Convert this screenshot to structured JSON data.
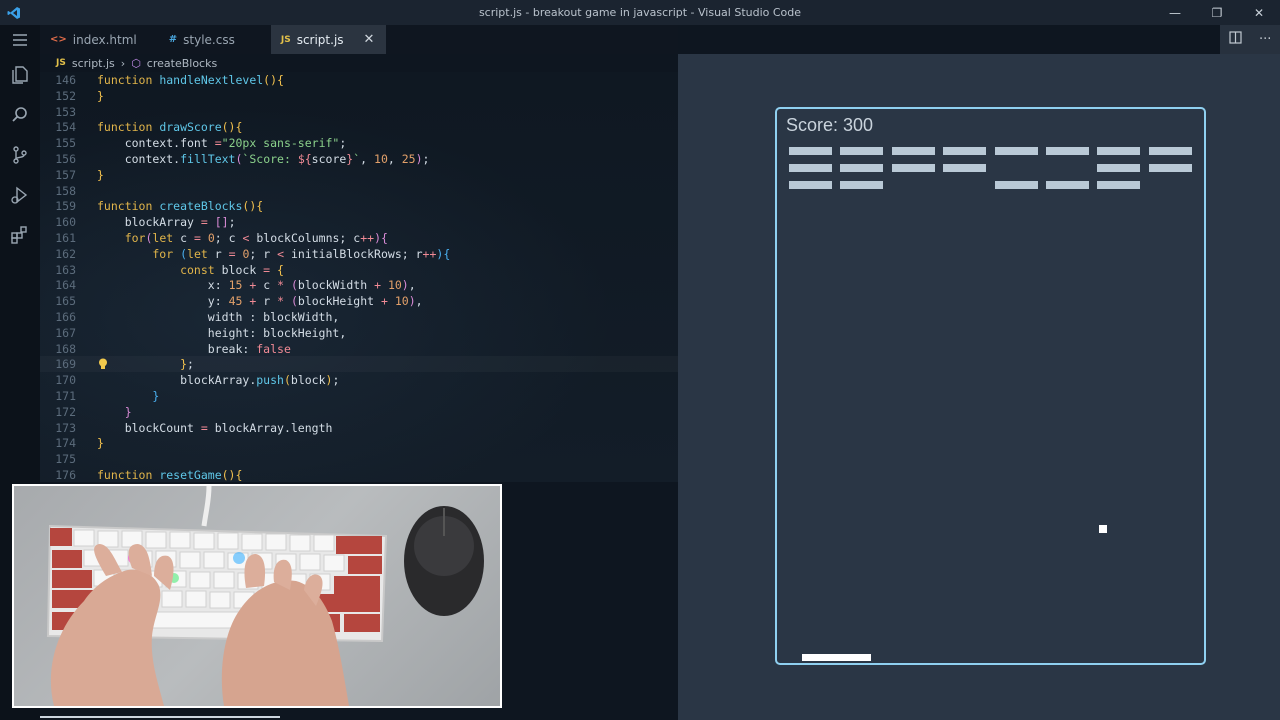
{
  "window": {
    "title": "script.js - breakout game in javascript - Visual Studio Code",
    "controls": {
      "minimize": "—",
      "maximize": "❐",
      "close": "✕"
    }
  },
  "activitybar": {
    "icons": [
      "files-icon",
      "search-icon",
      "source-control-icon",
      "run-debug-icon",
      "extensions-icon"
    ]
  },
  "tabs": [
    {
      "label": "index.html",
      "icon": "<>",
      "icon_color": "#e06c4a",
      "active": false
    },
    {
      "label": "style.css",
      "icon": "#",
      "icon_color": "#4aa8e0",
      "active": false
    },
    {
      "label": "script.js",
      "icon": "JS",
      "icon_color": "#e3c14a",
      "active": true
    }
  ],
  "breadcrumb": {
    "file": "script.js",
    "file_icon": "JS",
    "symbol": "createBlocks"
  },
  "editor": {
    "lines": [
      {
        "n": "146",
        "tokens": [
          [
            "kw",
            "function "
          ],
          [
            "fn",
            "handleNextlevel"
          ],
          [
            "br1",
            "(){"
          ]
        ]
      },
      {
        "n": "152",
        "tokens": [
          [
            "br1",
            "}"
          ]
        ]
      },
      {
        "n": "153",
        "tokens": []
      },
      {
        "n": "154",
        "tokens": [
          [
            "kw",
            "function "
          ],
          [
            "fn",
            "drawScore"
          ],
          [
            "br1",
            "(){"
          ]
        ]
      },
      {
        "n": "155",
        "tokens": [
          [
            "pn",
            "    context.font "
          ],
          [
            "op",
            "="
          ],
          [
            "str",
            "\"20px sans-serif\""
          ],
          [
            "pn",
            ";"
          ]
        ]
      },
      {
        "n": "156",
        "tokens": [
          [
            "pn",
            "    context."
          ],
          [
            "fn",
            "fillText"
          ],
          [
            "br2",
            "("
          ],
          [
            "str",
            "`Score: "
          ],
          [
            "op",
            "${"
          ],
          [
            "pn",
            "score"
          ],
          [
            "op",
            "}"
          ],
          [
            "str",
            "`"
          ],
          [
            "pn",
            ", "
          ],
          [
            "num",
            "10"
          ],
          [
            "pn",
            ", "
          ],
          [
            "num",
            "25"
          ],
          [
            "br2",
            ")"
          ],
          [
            "pn",
            ";"
          ]
        ]
      },
      {
        "n": "157",
        "tokens": [
          [
            "br1",
            "}"
          ]
        ]
      },
      {
        "n": "158",
        "tokens": []
      },
      {
        "n": "159",
        "tokens": [
          [
            "kw",
            "function "
          ],
          [
            "fn",
            "createBlocks"
          ],
          [
            "br1",
            "(){"
          ]
        ]
      },
      {
        "n": "160",
        "tokens": [
          [
            "pn",
            "    blockArray "
          ],
          [
            "op",
            "="
          ],
          [
            "pn",
            " "
          ],
          [
            "br2",
            "[]"
          ],
          [
            "pn",
            ";"
          ]
        ]
      },
      {
        "n": "161",
        "tokens": [
          [
            "kw",
            "    for"
          ],
          [
            "br2",
            "("
          ],
          [
            "kw",
            "let "
          ],
          [
            "pn",
            "c "
          ],
          [
            "op",
            "="
          ],
          [
            "pn",
            " "
          ],
          [
            "num",
            "0"
          ],
          [
            "pn",
            "; c "
          ],
          [
            "op",
            "<"
          ],
          [
            "pn",
            " blockColumns; c"
          ],
          [
            "op",
            "++"
          ],
          [
            "br2",
            "){"
          ]
        ]
      },
      {
        "n": "162",
        "tokens": [
          [
            "kw",
            "        for "
          ],
          [
            "br3",
            "("
          ],
          [
            "kw",
            "let "
          ],
          [
            "pn",
            "r "
          ],
          [
            "op",
            "="
          ],
          [
            "pn",
            " "
          ],
          [
            "num",
            "0"
          ],
          [
            "pn",
            "; r "
          ],
          [
            "op",
            "<"
          ],
          [
            "pn",
            " initialBlockRows; r"
          ],
          [
            "op",
            "++"
          ],
          [
            "br3",
            "){"
          ]
        ]
      },
      {
        "n": "163",
        "tokens": [
          [
            "kw",
            "            const "
          ],
          [
            "pn",
            "block "
          ],
          [
            "op",
            "="
          ],
          [
            "pn",
            " "
          ],
          [
            "br1",
            "{"
          ]
        ]
      },
      {
        "n": "164",
        "tokens": [
          [
            "pn",
            "                x: "
          ],
          [
            "num",
            "15"
          ],
          [
            "pn",
            " "
          ],
          [
            "op",
            "+"
          ],
          [
            "pn",
            " c "
          ],
          [
            "op",
            "*"
          ],
          [
            "pn",
            " "
          ],
          [
            "br2",
            "("
          ],
          [
            "pn",
            "blockWidth "
          ],
          [
            "op",
            "+"
          ],
          [
            "pn",
            " "
          ],
          [
            "num",
            "10"
          ],
          [
            "br2",
            ")"
          ],
          [
            "pn",
            ","
          ]
        ]
      },
      {
        "n": "165",
        "tokens": [
          [
            "pn",
            "                y: "
          ],
          [
            "num",
            "45"
          ],
          [
            "pn",
            " "
          ],
          [
            "op",
            "+"
          ],
          [
            "pn",
            " r "
          ],
          [
            "op",
            "*"
          ],
          [
            "pn",
            " "
          ],
          [
            "br2",
            "("
          ],
          [
            "pn",
            "blockHeight "
          ],
          [
            "op",
            "+"
          ],
          [
            "pn",
            " "
          ],
          [
            "num",
            "10"
          ],
          [
            "br2",
            ")"
          ],
          [
            "pn",
            ","
          ]
        ]
      },
      {
        "n": "166",
        "tokens": [
          [
            "pn",
            "                width : blockWidth,"
          ]
        ]
      },
      {
        "n": "167",
        "tokens": [
          [
            "pn",
            "                height: blockHeight,"
          ]
        ]
      },
      {
        "n": "168",
        "tokens": [
          [
            "pn",
            "                break: "
          ],
          [
            "bool",
            "false"
          ]
        ]
      },
      {
        "n": "169",
        "tokens": [
          [
            "br1",
            "            }"
          ],
          [
            "pn",
            ";"
          ]
        ],
        "current": true,
        "lightbulb": true
      },
      {
        "n": "170",
        "tokens": [
          [
            "pn",
            "            blockArray."
          ],
          [
            "fn",
            "push"
          ],
          [
            "br1",
            "("
          ],
          [
            "pn",
            "block"
          ],
          [
            "br1",
            ")"
          ],
          [
            "pn",
            ";"
          ]
        ]
      },
      {
        "n": "171",
        "tokens": [
          [
            "br3",
            "        }"
          ]
        ]
      },
      {
        "n": "172",
        "tokens": [
          [
            "br2",
            "    }"
          ]
        ]
      },
      {
        "n": "173",
        "tokens": [
          [
            "pn",
            "    blockCount "
          ],
          [
            "op",
            "="
          ],
          [
            "pn",
            " blockArray.length"
          ]
        ]
      },
      {
        "n": "174",
        "tokens": [
          [
            "br1",
            "}"
          ]
        ]
      },
      {
        "n": "175",
        "tokens": []
      },
      {
        "n": "176",
        "tokens": [
          [
            "kw",
            "function "
          ],
          [
            "fn",
            "resetGame"
          ],
          [
            "br1",
            "(){"
          ]
        ]
      }
    ]
  },
  "game": {
    "score_text": "Score: 300",
    "columns": 8,
    "rows": 3,
    "blocks_present": [
      [
        true,
        true,
        true
      ],
      [
        true,
        true,
        true
      ],
      [
        true,
        true,
        false
      ],
      [
        true,
        true,
        false
      ],
      [
        true,
        false,
        true
      ],
      [
        true,
        false,
        true
      ],
      [
        true,
        true,
        true
      ],
      [
        true,
        true,
        false
      ]
    ],
    "colors": {
      "block": "#b9c9d6",
      "border": "#8fd0f0",
      "background": "#2a3645",
      "ball": "#ffffff",
      "paddle": "#ffffff"
    }
  }
}
